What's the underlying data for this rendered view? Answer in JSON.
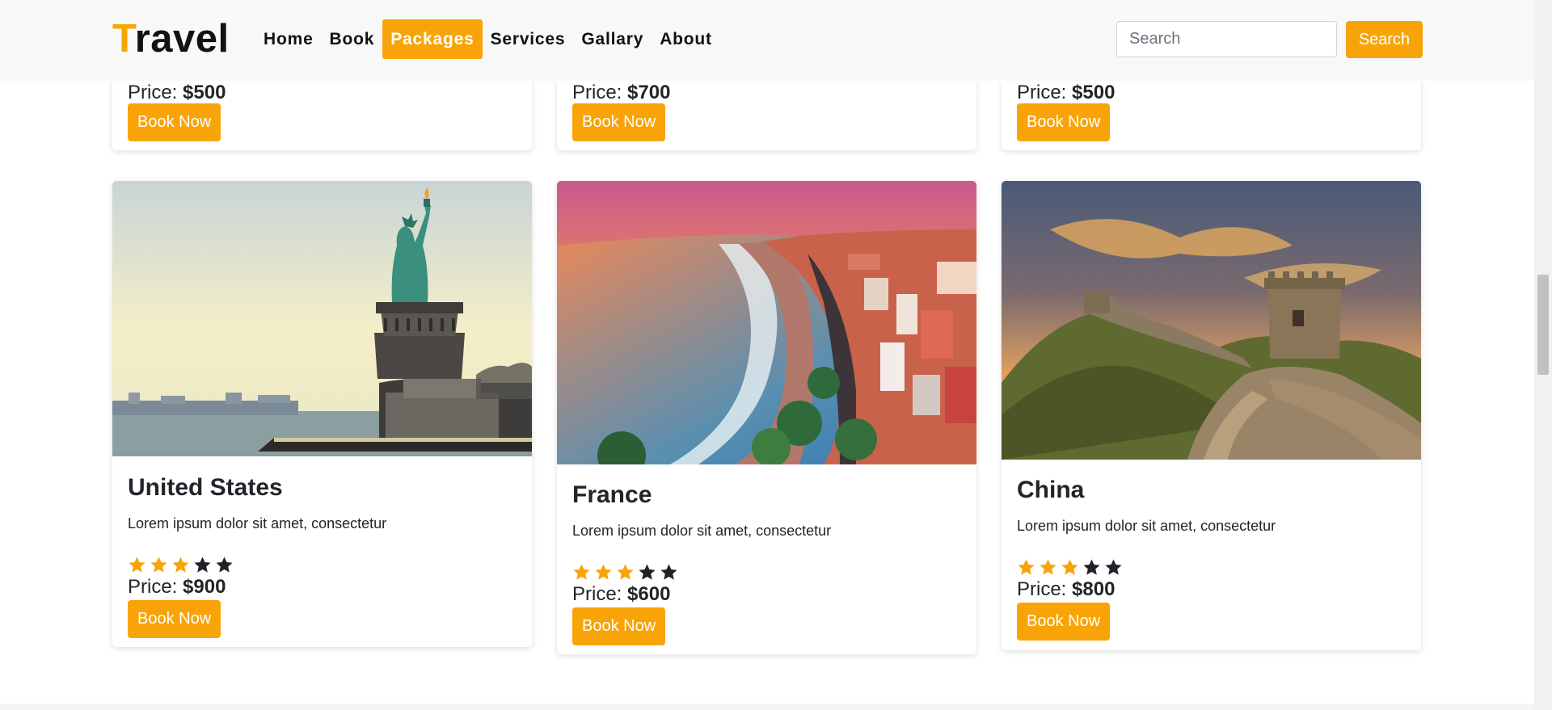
{
  "brand": {
    "first_letter": "T",
    "rest": "ravel",
    "accent_color": "#f7a700"
  },
  "nav": {
    "links": [
      {
        "label": "Home",
        "active": false
      },
      {
        "label": "Book",
        "active": false
      },
      {
        "label": "Packages",
        "active": true
      },
      {
        "label": "Services",
        "active": false
      },
      {
        "label": "Gallary",
        "active": false
      },
      {
        "label": "About",
        "active": false
      }
    ]
  },
  "search": {
    "placeholder": "Search",
    "button_label": "Search"
  },
  "accent_color": "#f8a408",
  "price_label": "Price:",
  "book_label": "Book Now",
  "top_cards": [
    {
      "price": "$500"
    },
    {
      "price": "$700"
    },
    {
      "price": "$500"
    }
  ],
  "cards": [
    {
      "title": "United States",
      "text": "Lorem ipsum dolor sit amet, consectetur",
      "rating": 3,
      "max_rating": 5,
      "price": "$900"
    },
    {
      "title": "France",
      "text": "Lorem ipsum dolor sit amet, consectetur",
      "rating": 3,
      "max_rating": 5,
      "price": "$600"
    },
    {
      "title": "China",
      "text": "Lorem ipsum dolor sit amet, consectetur",
      "rating": 3,
      "max_rating": 5,
      "price": "$800"
    }
  ]
}
